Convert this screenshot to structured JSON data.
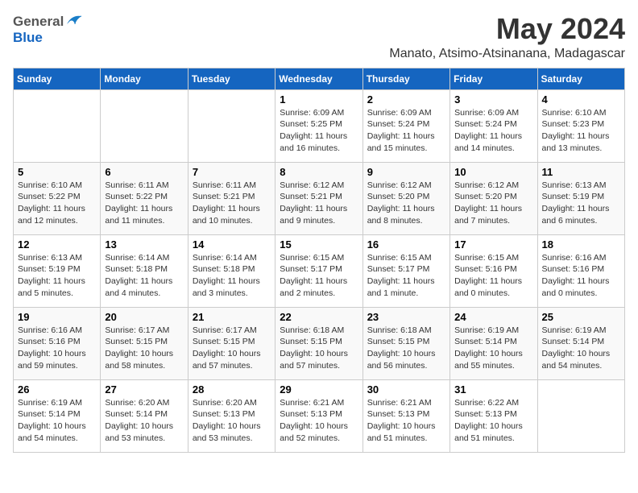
{
  "header": {
    "logo_general": "General",
    "logo_blue": "Blue",
    "month_year": "May 2024",
    "location": "Manato, Atsimo-Atsinanana, Madagascar"
  },
  "days_of_week": [
    "Sunday",
    "Monday",
    "Tuesday",
    "Wednesday",
    "Thursday",
    "Friday",
    "Saturday"
  ],
  "weeks": [
    [
      {
        "day": "",
        "info": ""
      },
      {
        "day": "",
        "info": ""
      },
      {
        "day": "",
        "info": ""
      },
      {
        "day": "1",
        "info": "Sunrise: 6:09 AM\nSunset: 5:25 PM\nDaylight: 11 hours\nand 16 minutes."
      },
      {
        "day": "2",
        "info": "Sunrise: 6:09 AM\nSunset: 5:24 PM\nDaylight: 11 hours\nand 15 minutes."
      },
      {
        "day": "3",
        "info": "Sunrise: 6:09 AM\nSunset: 5:24 PM\nDaylight: 11 hours\nand 14 minutes."
      },
      {
        "day": "4",
        "info": "Sunrise: 6:10 AM\nSunset: 5:23 PM\nDaylight: 11 hours\nand 13 minutes."
      }
    ],
    [
      {
        "day": "5",
        "info": "Sunrise: 6:10 AM\nSunset: 5:22 PM\nDaylight: 11 hours\nand 12 minutes."
      },
      {
        "day": "6",
        "info": "Sunrise: 6:11 AM\nSunset: 5:22 PM\nDaylight: 11 hours\nand 11 minutes."
      },
      {
        "day": "7",
        "info": "Sunrise: 6:11 AM\nSunset: 5:21 PM\nDaylight: 11 hours\nand 10 minutes."
      },
      {
        "day": "8",
        "info": "Sunrise: 6:12 AM\nSunset: 5:21 PM\nDaylight: 11 hours\nand 9 minutes."
      },
      {
        "day": "9",
        "info": "Sunrise: 6:12 AM\nSunset: 5:20 PM\nDaylight: 11 hours\nand 8 minutes."
      },
      {
        "day": "10",
        "info": "Sunrise: 6:12 AM\nSunset: 5:20 PM\nDaylight: 11 hours\nand 7 minutes."
      },
      {
        "day": "11",
        "info": "Sunrise: 6:13 AM\nSunset: 5:19 PM\nDaylight: 11 hours\nand 6 minutes."
      }
    ],
    [
      {
        "day": "12",
        "info": "Sunrise: 6:13 AM\nSunset: 5:19 PM\nDaylight: 11 hours\nand 5 minutes."
      },
      {
        "day": "13",
        "info": "Sunrise: 6:14 AM\nSunset: 5:18 PM\nDaylight: 11 hours\nand 4 minutes."
      },
      {
        "day": "14",
        "info": "Sunrise: 6:14 AM\nSunset: 5:18 PM\nDaylight: 11 hours\nand 3 minutes."
      },
      {
        "day": "15",
        "info": "Sunrise: 6:15 AM\nSunset: 5:17 PM\nDaylight: 11 hours\nand 2 minutes."
      },
      {
        "day": "16",
        "info": "Sunrise: 6:15 AM\nSunset: 5:17 PM\nDaylight: 11 hours\nand 1 minute."
      },
      {
        "day": "17",
        "info": "Sunrise: 6:15 AM\nSunset: 5:16 PM\nDaylight: 11 hours\nand 0 minutes."
      },
      {
        "day": "18",
        "info": "Sunrise: 6:16 AM\nSunset: 5:16 PM\nDaylight: 11 hours\nand 0 minutes."
      }
    ],
    [
      {
        "day": "19",
        "info": "Sunrise: 6:16 AM\nSunset: 5:16 PM\nDaylight: 10 hours\nand 59 minutes."
      },
      {
        "day": "20",
        "info": "Sunrise: 6:17 AM\nSunset: 5:15 PM\nDaylight: 10 hours\nand 58 minutes."
      },
      {
        "day": "21",
        "info": "Sunrise: 6:17 AM\nSunset: 5:15 PM\nDaylight: 10 hours\nand 57 minutes."
      },
      {
        "day": "22",
        "info": "Sunrise: 6:18 AM\nSunset: 5:15 PM\nDaylight: 10 hours\nand 57 minutes."
      },
      {
        "day": "23",
        "info": "Sunrise: 6:18 AM\nSunset: 5:15 PM\nDaylight: 10 hours\nand 56 minutes."
      },
      {
        "day": "24",
        "info": "Sunrise: 6:19 AM\nSunset: 5:14 PM\nDaylight: 10 hours\nand 55 minutes."
      },
      {
        "day": "25",
        "info": "Sunrise: 6:19 AM\nSunset: 5:14 PM\nDaylight: 10 hours\nand 54 minutes."
      }
    ],
    [
      {
        "day": "26",
        "info": "Sunrise: 6:19 AM\nSunset: 5:14 PM\nDaylight: 10 hours\nand 54 minutes."
      },
      {
        "day": "27",
        "info": "Sunrise: 6:20 AM\nSunset: 5:14 PM\nDaylight: 10 hours\nand 53 minutes."
      },
      {
        "day": "28",
        "info": "Sunrise: 6:20 AM\nSunset: 5:13 PM\nDaylight: 10 hours\nand 53 minutes."
      },
      {
        "day": "29",
        "info": "Sunrise: 6:21 AM\nSunset: 5:13 PM\nDaylight: 10 hours\nand 52 minutes."
      },
      {
        "day": "30",
        "info": "Sunrise: 6:21 AM\nSunset: 5:13 PM\nDaylight: 10 hours\nand 51 minutes."
      },
      {
        "day": "31",
        "info": "Sunrise: 6:22 AM\nSunset: 5:13 PM\nDaylight: 10 hours\nand 51 minutes."
      },
      {
        "day": "",
        "info": ""
      }
    ]
  ]
}
